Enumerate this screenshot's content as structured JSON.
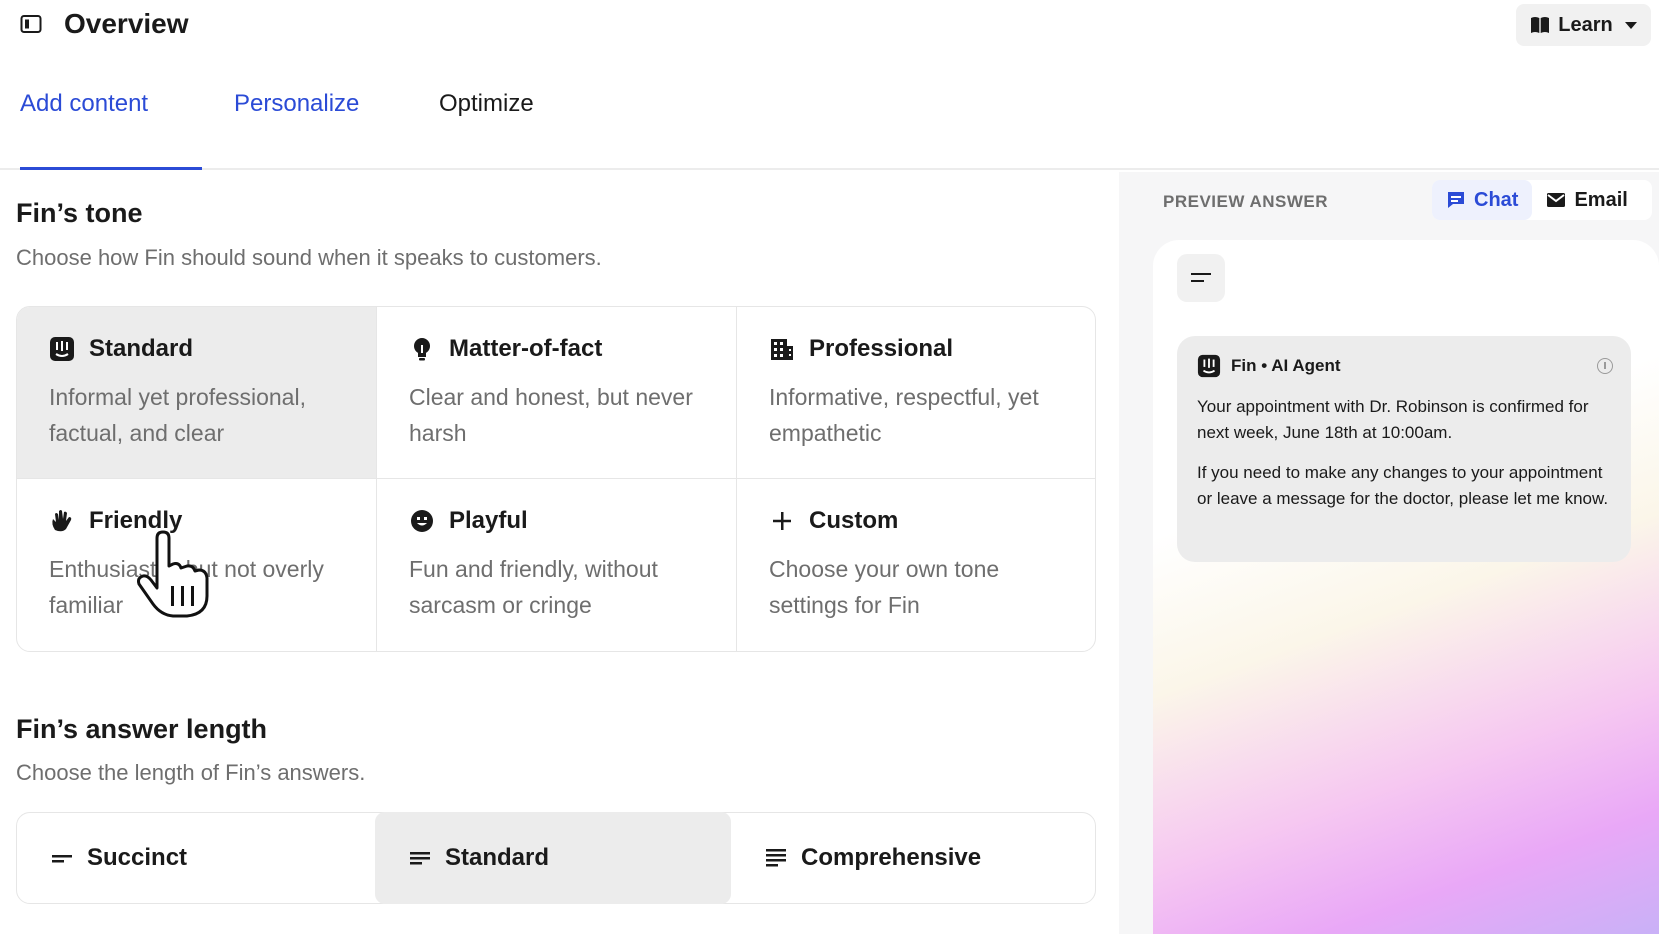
{
  "header": {
    "title": "Overview",
    "learn_label": "Learn"
  },
  "tabs": [
    {
      "label": "Add content"
    },
    {
      "label": "Personalize"
    },
    {
      "label": "Optimize"
    }
  ],
  "tone": {
    "title": "Fin’s tone",
    "description": "Choose how Fin should sound when it speaks to customers.",
    "options": [
      {
        "label": "Standard",
        "desc": "Informal yet professional, factual, and clear",
        "icon": "fin-logo-icon",
        "selected": true
      },
      {
        "label": "Matter-of-fact",
        "desc": "Clear and honest, but never harsh",
        "icon": "lightbulb-icon"
      },
      {
        "label": "Professional",
        "desc": "Informative, respectful, yet empathetic",
        "icon": "building-icon"
      },
      {
        "label": "Friendly",
        "desc": "Enthusiastic, but not overly familiar",
        "icon": "waving-hand-icon"
      },
      {
        "label": "Playful",
        "desc": "Fun and friendly, without sarcasm or cringe",
        "icon": "smiley-icon"
      },
      {
        "label": "Custom",
        "desc": "Choose your own tone settings for Fin",
        "icon": "plus-icon"
      }
    ]
  },
  "length": {
    "title": "Fin’s answer length",
    "description": "Choose the length of Fin’s answers.",
    "options": [
      {
        "label": "Succinct",
        "icon": "short-lines-icon"
      },
      {
        "label": "Standard",
        "icon": "medium-lines-icon",
        "selected": true
      },
      {
        "label": "Comprehensive",
        "icon": "long-lines-icon"
      }
    ]
  },
  "preview": {
    "label": "PREVIEW ANSWER",
    "chat_label": "Chat",
    "email_label": "Email",
    "sender": "Fin • AI Agent",
    "message_1": "Your appointment with Dr. Robinson is confirmed for next week, June 18th at 10:00am.",
    "message_2": "If you need to make any changes to your appointment or leave a message for the doctor, please let me know."
  },
  "colors": {
    "accent": "#2b4bd6",
    "selected_bg": "#ececec",
    "muted_text": "#6e6e6e"
  }
}
